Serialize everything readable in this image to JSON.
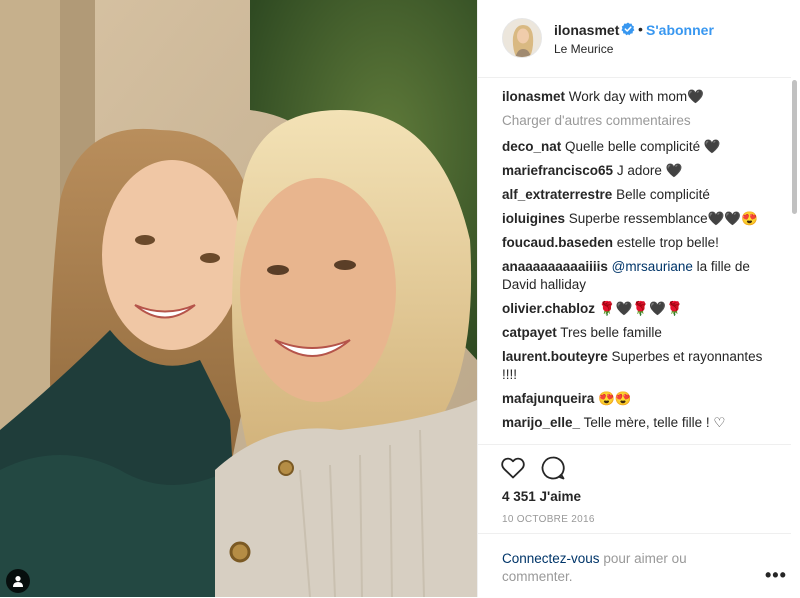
{
  "post": {
    "username": "ilonasmet",
    "separator": "•",
    "follow_label": "S'abonner",
    "location": "Le Meurice",
    "caption_user": "ilonasmet",
    "caption_text": "Work day with mom🖤"
  },
  "comments": {
    "load_more": "Charger d'autres commentaires",
    "items": [
      {
        "user": "deco_nat",
        "text": "Quelle belle complicité 🖤"
      },
      {
        "user": "mariefrancisco65",
        "text": "J adore 🖤"
      },
      {
        "user": "alf_extraterrestre",
        "text": "Belle complicité"
      },
      {
        "user": "ioluigines",
        "text": "Superbe ressemblance🖤🖤😍"
      },
      {
        "user": "foucaud.baseden",
        "text": "estelle trop belle!"
      },
      {
        "user": "anaaaaaaaaaiiiis",
        "mention": "@mrsauriane",
        "text": "la fille de David halliday"
      },
      {
        "user": "olivier.chabloz",
        "text": "🌹🖤🌹🖤🌹"
      },
      {
        "user": "catpayet",
        "text": "Tres belle famille"
      },
      {
        "user": "laurent.bouteyre",
        "text": "Superbes et rayonnantes !!!!"
      },
      {
        "user": "mafajunqueira",
        "text": "😍😍"
      },
      {
        "user": "marijo_elle_",
        "text": "Telle mère, telle fille ! ♡"
      }
    ]
  },
  "stats": {
    "likes": "4 351 J'aime",
    "date": "10 OCTOBRE 2016"
  },
  "footer": {
    "login_link": "Connectez-vous",
    "login_rest": " pour aimer ou commenter.",
    "more": "•••"
  },
  "icons": {
    "verified": "verified-badge-icon",
    "heart": "heart-icon",
    "comment": "comment-bubble-icon",
    "tag": "user-tag-icon"
  },
  "colors": {
    "link_blue": "#3897f0",
    "text": "#262626",
    "muted": "#999999",
    "mention": "#003569"
  }
}
